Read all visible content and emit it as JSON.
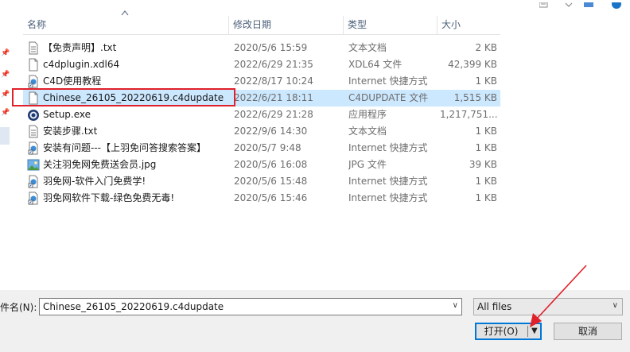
{
  "columns": {
    "name": "名称",
    "date": "修改日期",
    "type": "类型",
    "size": "大小"
  },
  "files": [
    {
      "name": "【免责声明】.txt",
      "date": "2020/5/6 15:59",
      "type": "文本文档",
      "size": "2 KB",
      "icon": "text-file-icon"
    },
    {
      "name": "c4dplugin.xdl64",
      "date": "2022/6/29 21:35",
      "type": "XDL64 文件",
      "size": "42,399 KB",
      "icon": "blank-file-icon"
    },
    {
      "name": "C4D使用教程",
      "date": "2022/8/17 10:24",
      "type": "Internet 快捷方式",
      "size": "1 KB",
      "icon": "internet-shortcut-icon"
    },
    {
      "name": "Chinese_26105_20220619.c4dupdate",
      "date": "2022/6/21 18:11",
      "type": "C4DUPDATE 文件",
      "size": "1,515 KB",
      "icon": "blank-file-icon"
    },
    {
      "name": "Setup.exe",
      "date": "2022/6/29 21:28",
      "type": "应用程序",
      "size": "1,217,751...",
      "icon": "cinema4d-app-icon"
    },
    {
      "name": "安装步骤.txt",
      "date": "2022/9/6 14:30",
      "type": "文本文档",
      "size": "1 KB",
      "icon": "text-file-icon"
    },
    {
      "name": "安装有问题---【上羽免问答搜索答案】",
      "date": "2020/5/7 9:48",
      "type": "Internet 快捷方式",
      "size": "1 KB",
      "icon": "internet-shortcut-icon"
    },
    {
      "name": "关注羽免网免费送会员.jpg",
      "date": "2020/5/6 16:08",
      "type": "JPG 文件",
      "size": "39 KB",
      "icon": "image-file-icon"
    },
    {
      "name": "羽免网-软件入门免费学!",
      "date": "2020/5/6 15:48",
      "type": "Internet 快捷方式",
      "size": "1 KB",
      "icon": "internet-shortcut-icon"
    },
    {
      "name": "羽免网软件下载-绿色免费无毒!",
      "date": "2020/5/6 15:46",
      "type": "Internet 快捷方式",
      "size": "1 KB",
      "icon": "internet-shortcut-icon"
    }
  ],
  "selected_index": 3,
  "bottom": {
    "filename_label": "件名(N):",
    "filename_value": "Chinese_26105_20220619.c4dupdate",
    "filter_value": "All files",
    "open_label": "打开(O)",
    "cancel_label": "取消"
  },
  "colors": {
    "selection": "#cce8ff",
    "highlight_box": "#e0202a",
    "annotation_arrow": "#e0202a",
    "accent": "#0078d7"
  }
}
